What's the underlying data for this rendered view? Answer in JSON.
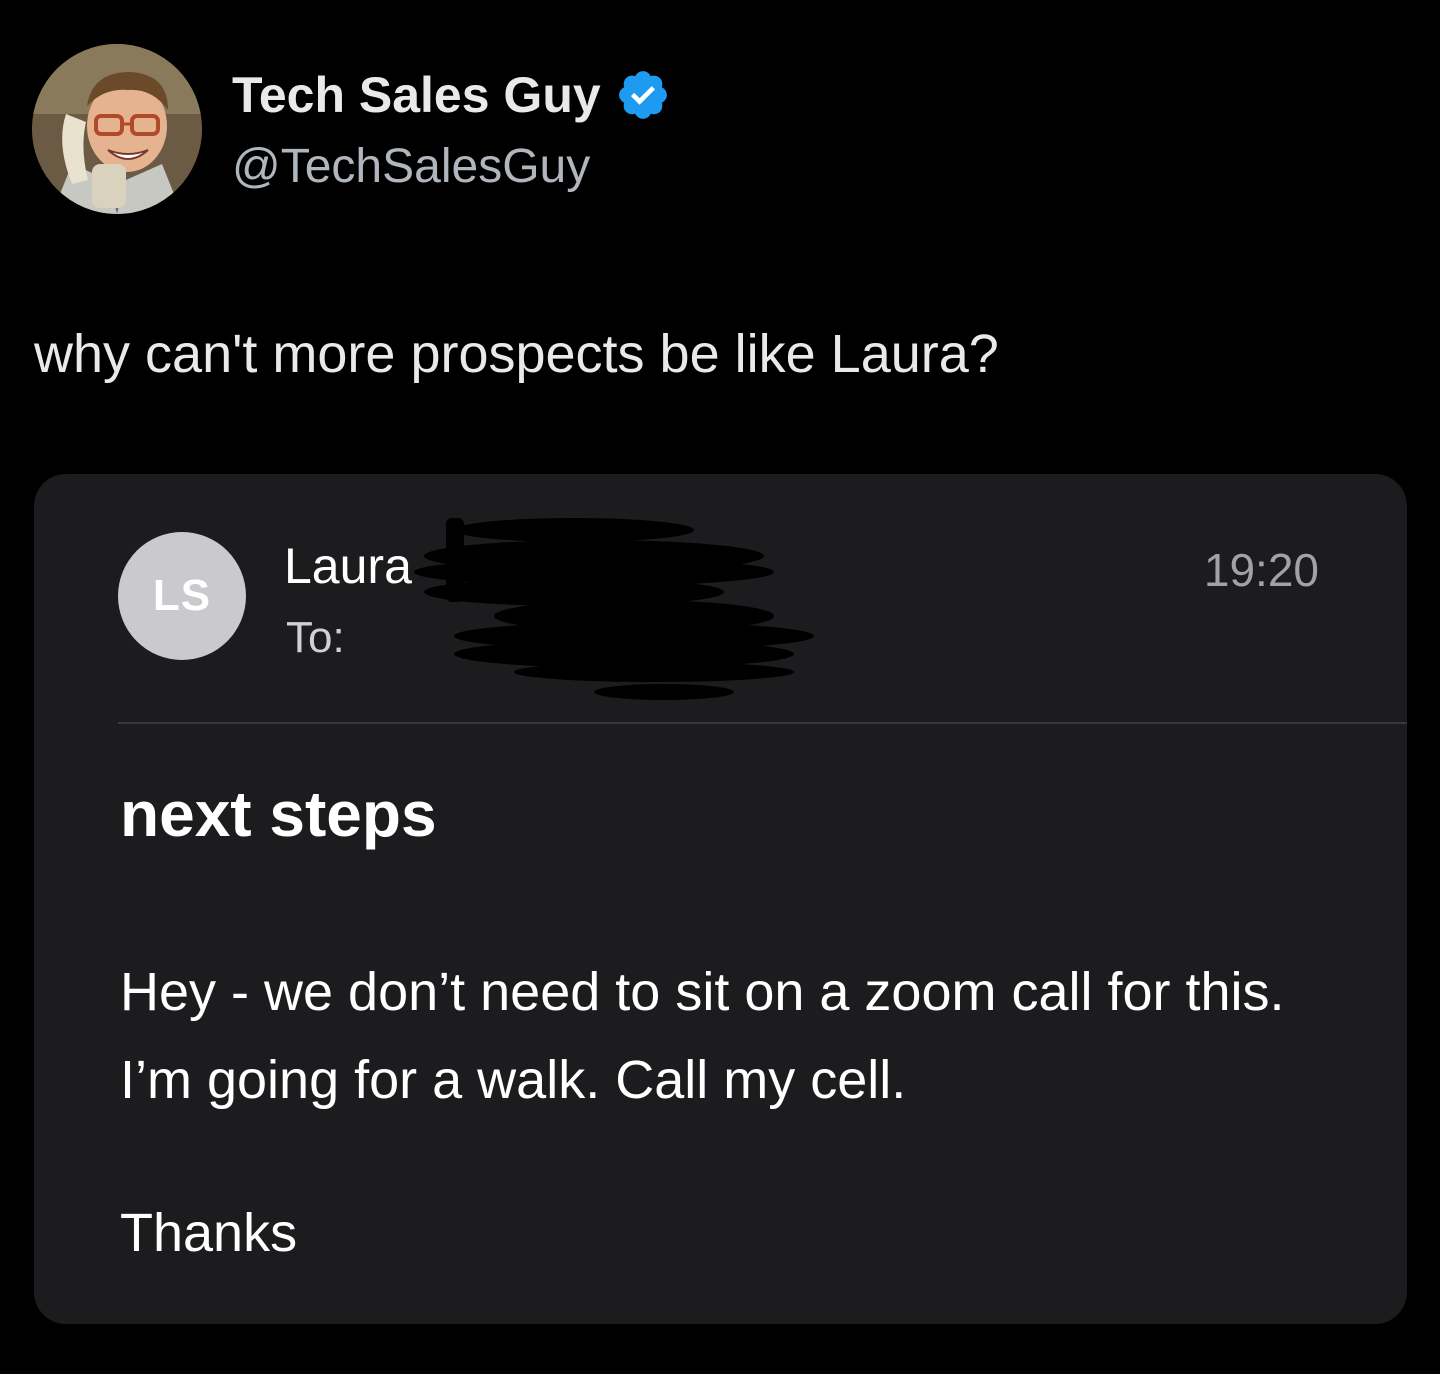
{
  "tweet": {
    "author": {
      "name": "Tech Sales Guy",
      "handle": "@TechSalesGuy",
      "verified": true,
      "avatar_icon": "profile-photo-man-on-phone"
    },
    "text": "why can't more prospects be like Laura?"
  },
  "email": {
    "sender_initials": "LS",
    "sender_name": "Laura",
    "recipient_label": "To:",
    "time": "19:20",
    "subject": "next steps",
    "body": "Hey - we don’t need to sit on a zoom call for this. I’m going for a walk. Call my cell.",
    "signoff": "Thanks"
  },
  "colors": {
    "background": "#000000",
    "card_background": "#1c1c1e",
    "verified_badge": "#1d9bf0",
    "sender_avatar": "#c9c9ce"
  }
}
